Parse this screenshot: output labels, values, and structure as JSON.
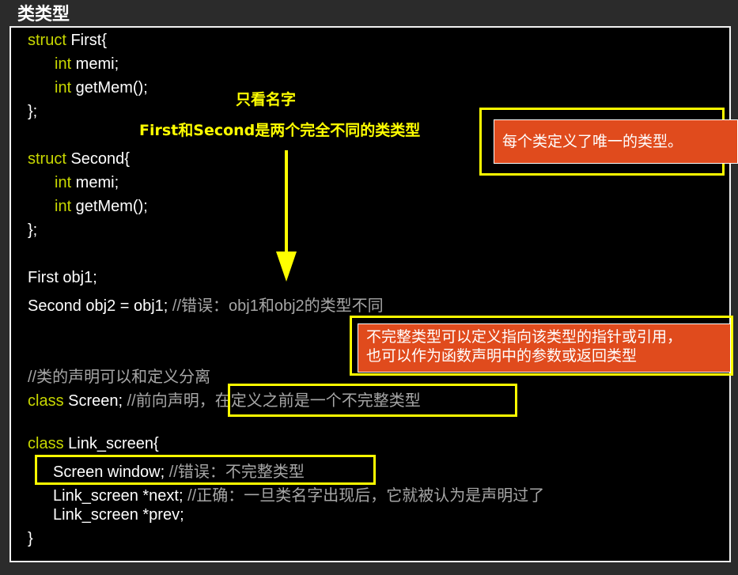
{
  "title": "类类型",
  "code": {
    "l1": {
      "kw": "struct",
      "text": " First{"
    },
    "l2": {
      "kw": "int",
      "text": " memi;"
    },
    "l3": {
      "kw": "int",
      "text": " getMem();"
    },
    "l4": {
      "text": "};"
    },
    "l5": {
      "kw": "struct",
      "text": " Second{"
    },
    "l6": {
      "kw": "int",
      "text": " memi;"
    },
    "l7": {
      "kw": "int",
      "text": " getMem();"
    },
    "l8": {
      "text": "};"
    },
    "l9": {
      "text": "First obj1;"
    },
    "l10": {
      "text": "Second obj2 = obj1; ",
      "comment": "//错误：obj1和obj2的类型不同"
    },
    "l11": {
      "comment": "//类的声明可以和定义分离"
    },
    "l12": {
      "kw": "class",
      "text": " Screen; ",
      "comment": "//前向声明，在定义之前是一个不完整类型"
    },
    "l13": {
      "kw": "class",
      "text": " Link_screen{"
    },
    "l14": {
      "text": "Screen window; ",
      "comment": "//错误：不完整类型"
    },
    "l15": {
      "text": "Link_screen *next; ",
      "comment": "//正确：一旦类名字出现后，它就被认为是声明过了"
    },
    "l16": {
      "text": "Link_screen *prev;"
    },
    "l17": {
      "text": "}"
    }
  },
  "annotations": {
    "note_line1": "只看名字",
    "note_line2": "First和Second是两个完全不同的类类型",
    "box1": "每个类定义了唯一的类型。",
    "box2_line1": "不完整类型可以定义指向该类型的指针或引用，",
    "box2_line2": "也可以作为函数声明中的参数或返回类型"
  },
  "colors": {
    "keyword": "#c8d800",
    "comment": "#a6a6a6",
    "highlight": "#ffff00",
    "callout": "#e04b1d"
  }
}
